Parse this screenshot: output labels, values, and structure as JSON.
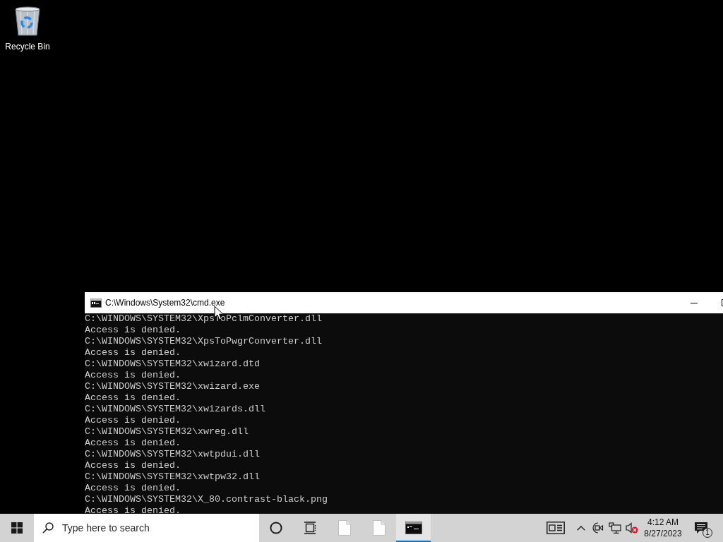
{
  "desktop": {
    "icons": [
      {
        "kind": "recycle_bin",
        "label": "Recycle Bin"
      }
    ]
  },
  "console_window": {
    "title": "C:\\Windows\\System32\\cmd.exe",
    "lines": [
      "C:\\WINDOWS\\SYSTEM32\\XpsToPclmConverter.dll",
      "Access is denied.",
      "C:\\WINDOWS\\SYSTEM32\\XpsToPwgrConverter.dll",
      "Access is denied.",
      "C:\\WINDOWS\\SYSTEM32\\xwizard.dtd",
      "Access is denied.",
      "C:\\WINDOWS\\SYSTEM32\\xwizard.exe",
      "Access is denied.",
      "C:\\WINDOWS\\SYSTEM32\\xwizards.dll",
      "Access is denied.",
      "C:\\WINDOWS\\SYSTEM32\\xwreg.dll",
      "Access is denied.",
      "C:\\WINDOWS\\SYSTEM32\\xwtpdui.dll",
      "Access is denied.",
      "C:\\WINDOWS\\SYSTEM32\\xwtpw32.dll",
      "Access is denied.",
      "C:\\WINDOWS\\SYSTEM32\\X_80.contrast-black.png",
      "Access is denied."
    ]
  },
  "taskbar": {
    "search": {
      "placeholder": "Type here to search"
    },
    "apps": [
      {
        "kind": "file",
        "selected": false
      },
      {
        "kind": "file",
        "selected": false
      },
      {
        "kind": "console",
        "selected": true
      }
    ],
    "tray": {
      "volume_muted": true,
      "time": "4:12 AM",
      "date": "8/27/2023",
      "notification_count": "1"
    }
  }
}
